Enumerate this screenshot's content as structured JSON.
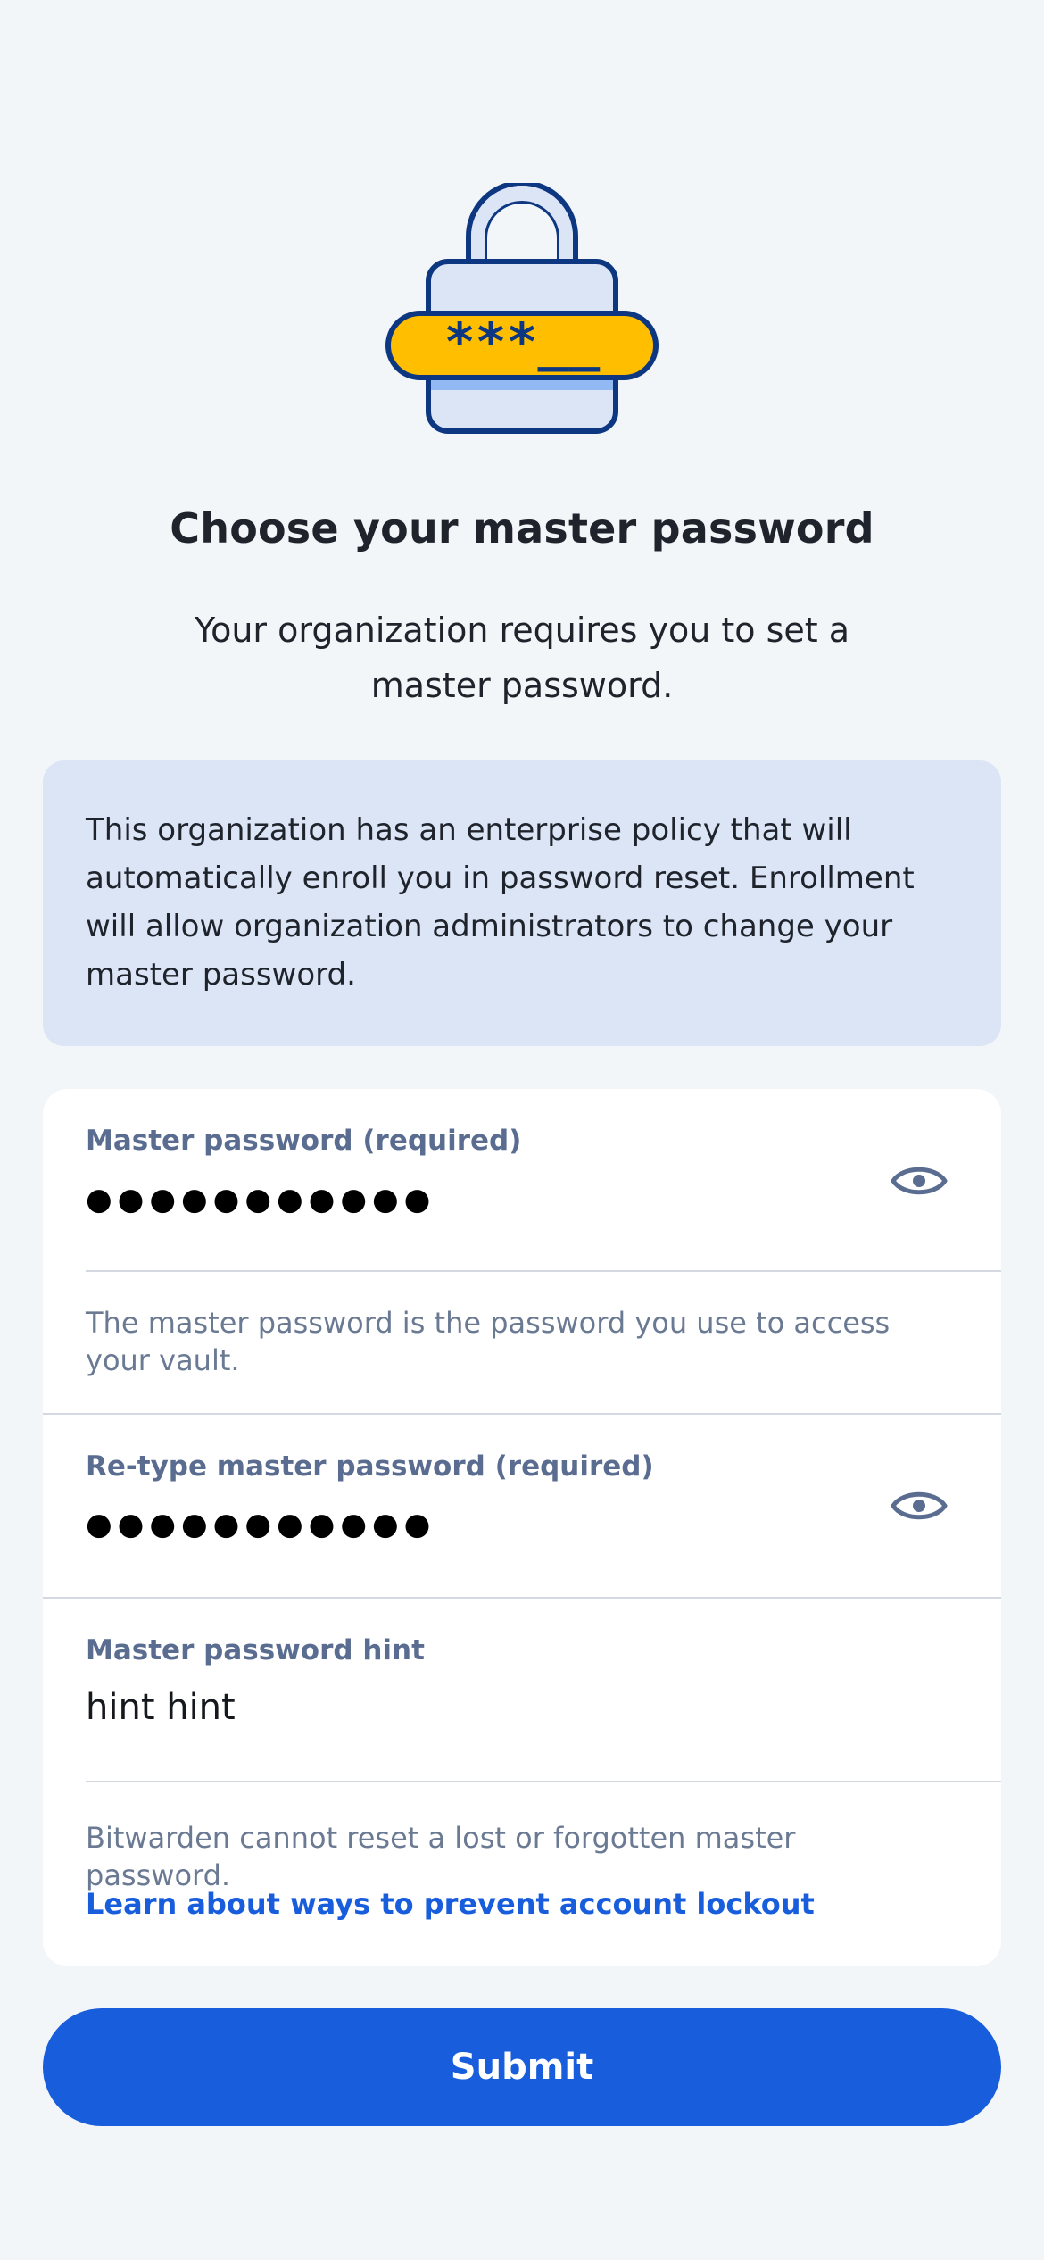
{
  "header": {
    "title": "Choose your master password",
    "subtitle": "Your organization requires you to set a master password.",
    "illustration": "lock-password-icon",
    "illustration_text": "***__"
  },
  "policy_callout": {
    "text": "This organization has an enterprise policy that will automatically enroll you in password reset. Enrollment will allow organization administrators to change your master password."
  },
  "form": {
    "master_password": {
      "label": "Master password (required)",
      "value": "●●●●●●●●●●●",
      "toggle_icon": "eye-icon"
    },
    "master_password_help": "The master password is the password you use to access your vault.",
    "retype_password": {
      "label": "Re-type master password (required)",
      "value": "●●●●●●●●●●●",
      "toggle_icon": "eye-icon"
    },
    "hint": {
      "label": "Master password hint",
      "value": "hint hint"
    },
    "warning": "Bitwarden cannot reset a lost or forgotten master password.",
    "learn_link": "Learn about ways to prevent account lockout"
  },
  "submit": {
    "label": "Submit"
  },
  "colors": {
    "background": "#f3f6f9",
    "accent": "#175ddc",
    "callout": "#dbe5f6",
    "lock_yellow": "#ffbf00",
    "lock_outline": "#0e3781"
  }
}
